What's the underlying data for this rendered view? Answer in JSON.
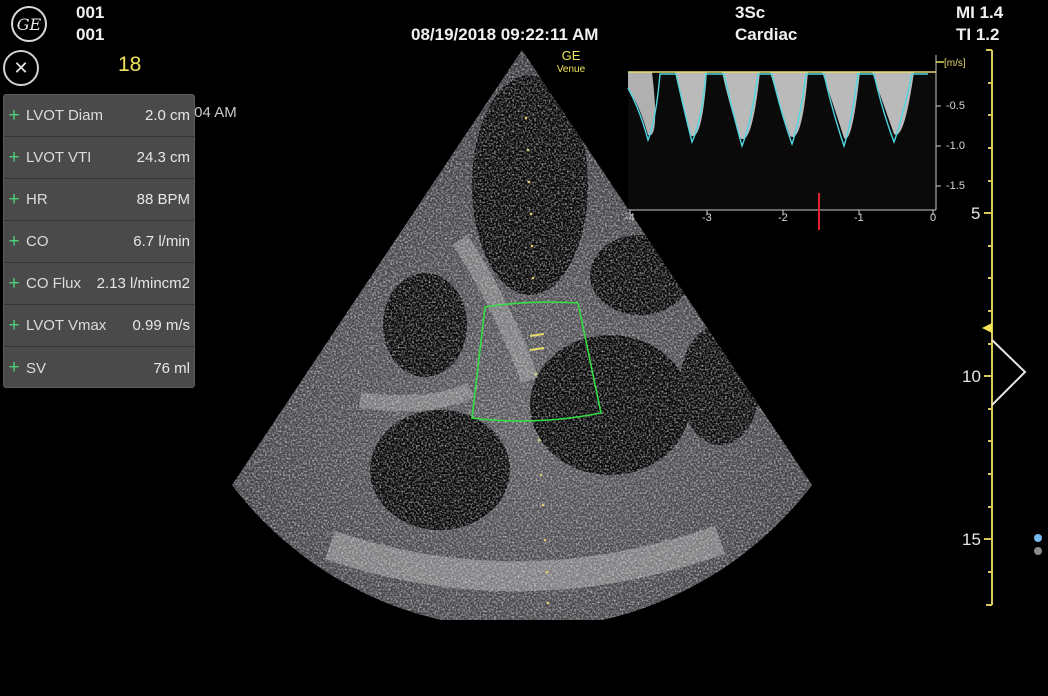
{
  "header": {
    "logo_text": "GE",
    "patient_line1": "001",
    "patient_line2": "001",
    "datetime": "08/19/2018 09:22:11 AM",
    "probe": "3Sc",
    "preset": "Cardiac",
    "mi": "MI 1.4",
    "ti": "TI 1.2"
  },
  "frame_count": "18",
  "ghost_time": ":04 AM",
  "close_glyph": "✕",
  "measurements": [
    {
      "label": "LVOT Diam",
      "value": "2.0 cm"
    },
    {
      "label": "LVOT VTI",
      "value": "24.3 cm"
    },
    {
      "label": "HR",
      "value": "88 BPM"
    },
    {
      "label": "CO",
      "value": "6.7 l/min"
    },
    {
      "label": "CO Flux",
      "value": "2.13 l/mincm2"
    },
    {
      "label": "LVOT Vmax",
      "value": "0.99 m/s"
    },
    {
      "label": "SV",
      "value": "76 ml"
    }
  ],
  "device_mark": {
    "brand": "GE",
    "model": "Venue"
  },
  "doppler": {
    "unit": "[m/s]",
    "y_ticks": [
      "-0.5",
      "-1.0",
      "-1.5"
    ],
    "x_ticks": [
      "-4",
      "-3",
      "-2",
      "-1",
      "0"
    ]
  },
  "depth_scale": {
    "labels": [
      "5",
      "10",
      "15"
    ]
  },
  "colors": {
    "accent_yellow": "#f1e35a",
    "roi_green": "#33dd44",
    "trace_cyan": "#4fd6e0",
    "plus_green": "#4fd07a",
    "marker_red": "#e0202a"
  },
  "icons": {
    "close": "close-icon",
    "plus": "plus-icon",
    "logo": "ge-logo-icon"
  }
}
